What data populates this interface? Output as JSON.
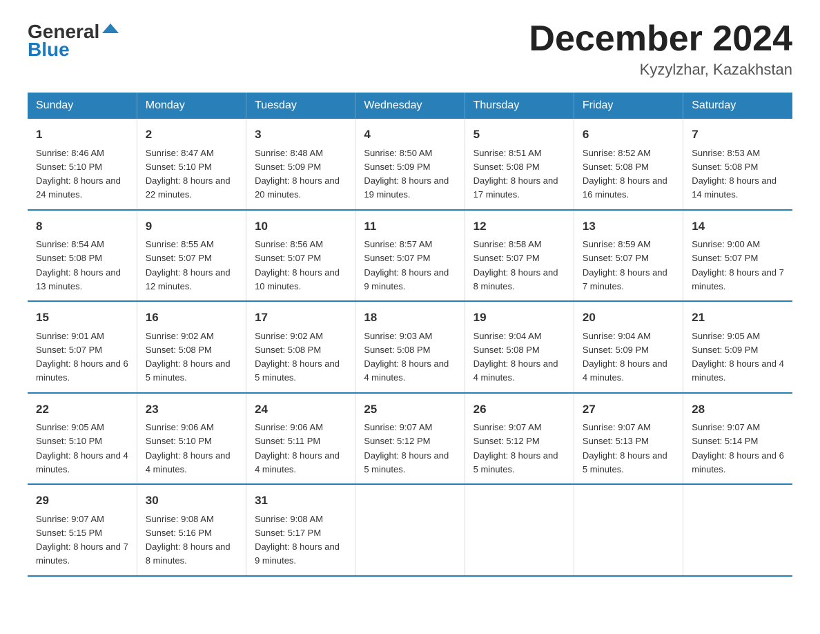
{
  "header": {
    "logo_general": "General",
    "logo_blue": "Blue",
    "month_title": "December 2024",
    "location": "Kyzylzhar, Kazakhstan"
  },
  "days_of_week": [
    "Sunday",
    "Monday",
    "Tuesday",
    "Wednesday",
    "Thursday",
    "Friday",
    "Saturday"
  ],
  "weeks": [
    [
      {
        "day": "1",
        "sunrise": "8:46 AM",
        "sunset": "5:10 PM",
        "daylight": "8 hours and 24 minutes."
      },
      {
        "day": "2",
        "sunrise": "8:47 AM",
        "sunset": "5:10 PM",
        "daylight": "8 hours and 22 minutes."
      },
      {
        "day": "3",
        "sunrise": "8:48 AM",
        "sunset": "5:09 PM",
        "daylight": "8 hours and 20 minutes."
      },
      {
        "day": "4",
        "sunrise": "8:50 AM",
        "sunset": "5:09 PM",
        "daylight": "8 hours and 19 minutes."
      },
      {
        "day": "5",
        "sunrise": "8:51 AM",
        "sunset": "5:08 PM",
        "daylight": "8 hours and 17 minutes."
      },
      {
        "day": "6",
        "sunrise": "8:52 AM",
        "sunset": "5:08 PM",
        "daylight": "8 hours and 16 minutes."
      },
      {
        "day": "7",
        "sunrise": "8:53 AM",
        "sunset": "5:08 PM",
        "daylight": "8 hours and 14 minutes."
      }
    ],
    [
      {
        "day": "8",
        "sunrise": "8:54 AM",
        "sunset": "5:08 PM",
        "daylight": "8 hours and 13 minutes."
      },
      {
        "day": "9",
        "sunrise": "8:55 AM",
        "sunset": "5:07 PM",
        "daylight": "8 hours and 12 minutes."
      },
      {
        "day": "10",
        "sunrise": "8:56 AM",
        "sunset": "5:07 PM",
        "daylight": "8 hours and 10 minutes."
      },
      {
        "day": "11",
        "sunrise": "8:57 AM",
        "sunset": "5:07 PM",
        "daylight": "8 hours and 9 minutes."
      },
      {
        "day": "12",
        "sunrise": "8:58 AM",
        "sunset": "5:07 PM",
        "daylight": "8 hours and 8 minutes."
      },
      {
        "day": "13",
        "sunrise": "8:59 AM",
        "sunset": "5:07 PM",
        "daylight": "8 hours and 7 minutes."
      },
      {
        "day": "14",
        "sunrise": "9:00 AM",
        "sunset": "5:07 PM",
        "daylight": "8 hours and 7 minutes."
      }
    ],
    [
      {
        "day": "15",
        "sunrise": "9:01 AM",
        "sunset": "5:07 PM",
        "daylight": "8 hours and 6 minutes."
      },
      {
        "day": "16",
        "sunrise": "9:02 AM",
        "sunset": "5:08 PM",
        "daylight": "8 hours and 5 minutes."
      },
      {
        "day": "17",
        "sunrise": "9:02 AM",
        "sunset": "5:08 PM",
        "daylight": "8 hours and 5 minutes."
      },
      {
        "day": "18",
        "sunrise": "9:03 AM",
        "sunset": "5:08 PM",
        "daylight": "8 hours and 4 minutes."
      },
      {
        "day": "19",
        "sunrise": "9:04 AM",
        "sunset": "5:08 PM",
        "daylight": "8 hours and 4 minutes."
      },
      {
        "day": "20",
        "sunrise": "9:04 AM",
        "sunset": "5:09 PM",
        "daylight": "8 hours and 4 minutes."
      },
      {
        "day": "21",
        "sunrise": "9:05 AM",
        "sunset": "5:09 PM",
        "daylight": "8 hours and 4 minutes."
      }
    ],
    [
      {
        "day": "22",
        "sunrise": "9:05 AM",
        "sunset": "5:10 PM",
        "daylight": "8 hours and 4 minutes."
      },
      {
        "day": "23",
        "sunrise": "9:06 AM",
        "sunset": "5:10 PM",
        "daylight": "8 hours and 4 minutes."
      },
      {
        "day": "24",
        "sunrise": "9:06 AM",
        "sunset": "5:11 PM",
        "daylight": "8 hours and 4 minutes."
      },
      {
        "day": "25",
        "sunrise": "9:07 AM",
        "sunset": "5:12 PM",
        "daylight": "8 hours and 5 minutes."
      },
      {
        "day": "26",
        "sunrise": "9:07 AM",
        "sunset": "5:12 PM",
        "daylight": "8 hours and 5 minutes."
      },
      {
        "day": "27",
        "sunrise": "9:07 AM",
        "sunset": "5:13 PM",
        "daylight": "8 hours and 5 minutes."
      },
      {
        "day": "28",
        "sunrise": "9:07 AM",
        "sunset": "5:14 PM",
        "daylight": "8 hours and 6 minutes."
      }
    ],
    [
      {
        "day": "29",
        "sunrise": "9:07 AM",
        "sunset": "5:15 PM",
        "daylight": "8 hours and 7 minutes."
      },
      {
        "day": "30",
        "sunrise": "9:08 AM",
        "sunset": "5:16 PM",
        "daylight": "8 hours and 8 minutes."
      },
      {
        "day": "31",
        "sunrise": "9:08 AM",
        "sunset": "5:17 PM",
        "daylight": "8 hours and 9 minutes."
      },
      null,
      null,
      null,
      null
    ]
  ]
}
